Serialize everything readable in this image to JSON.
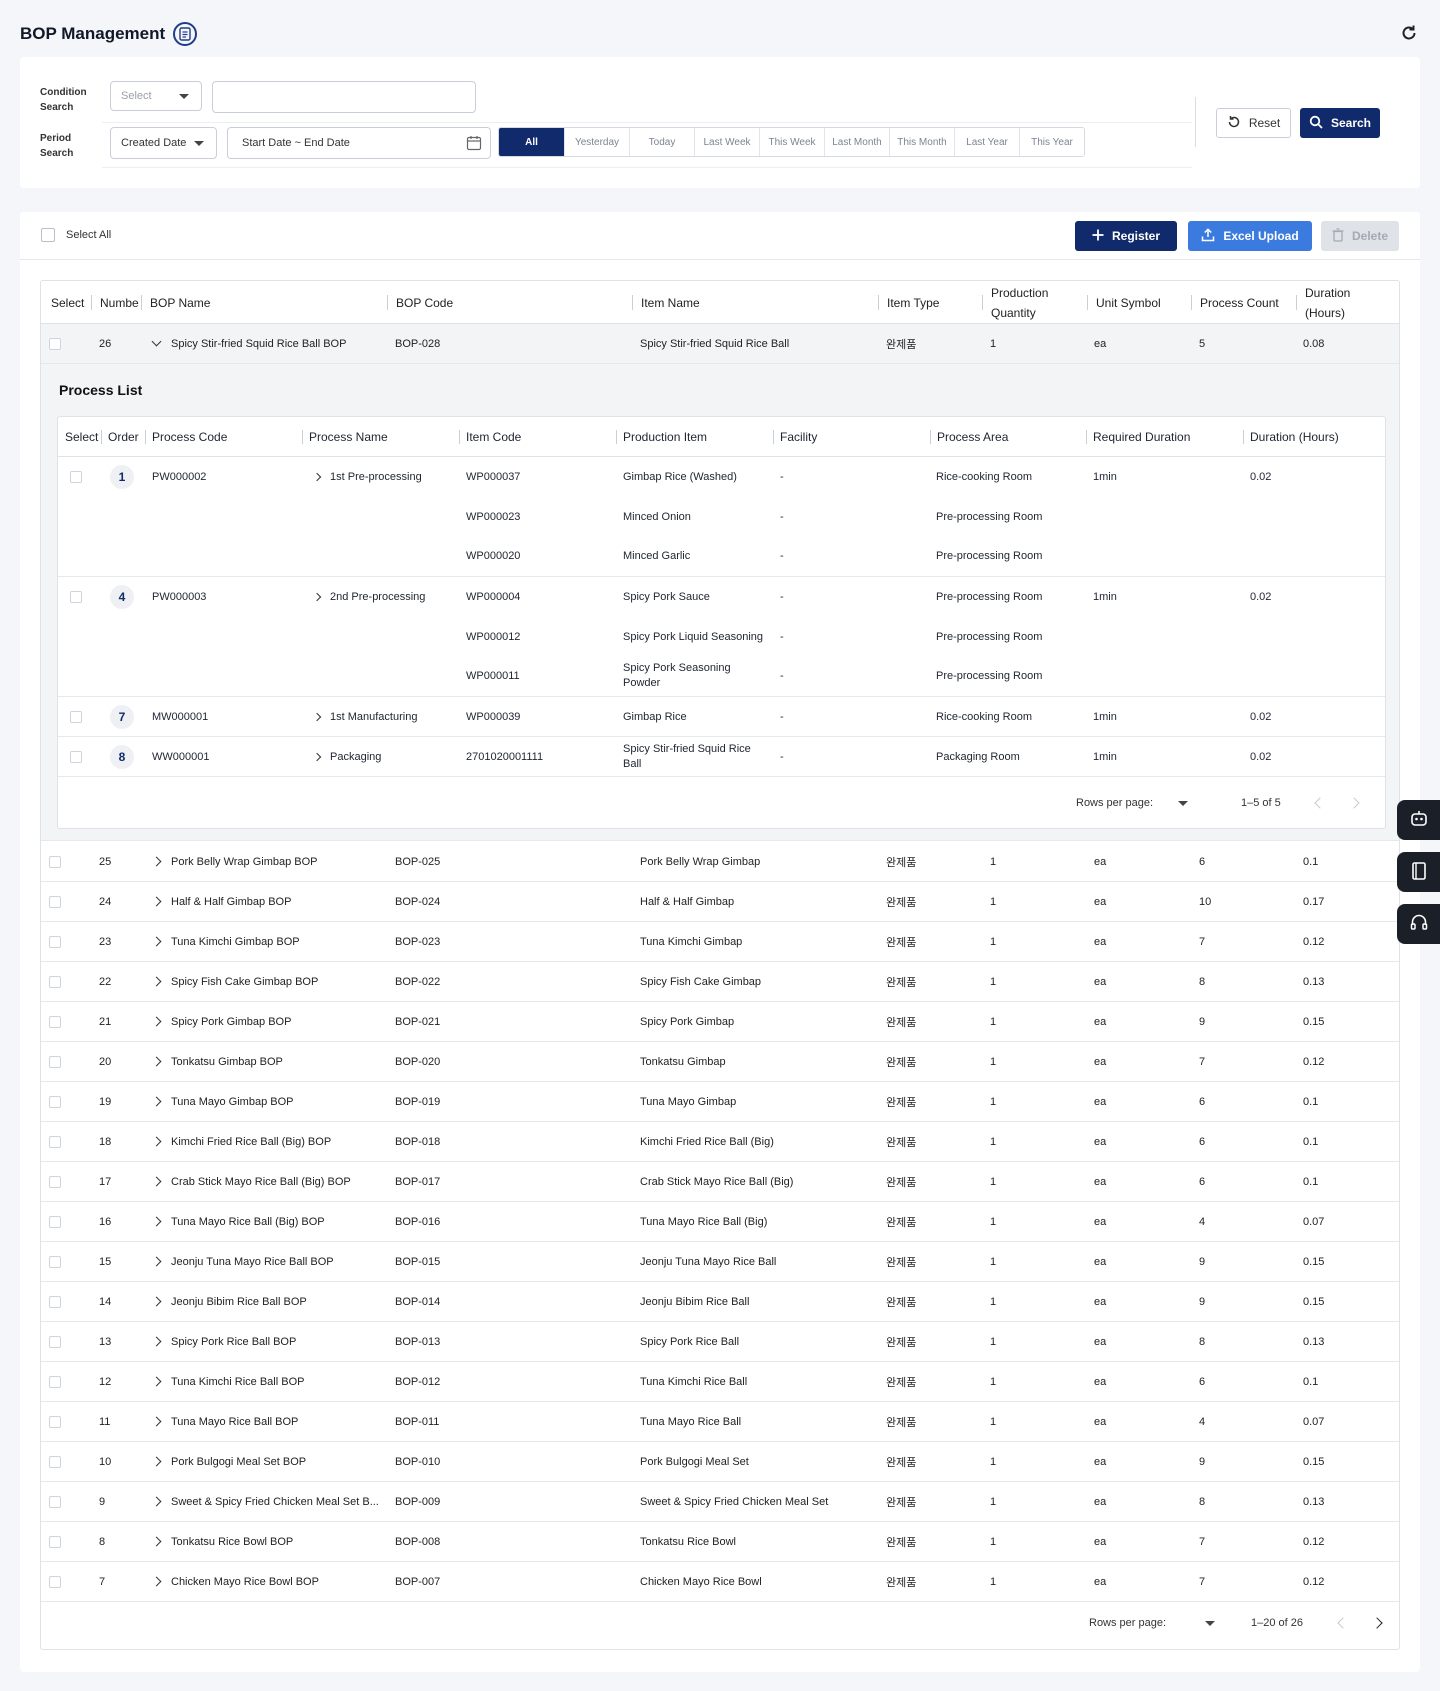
{
  "page": {
    "title": "BOP Management"
  },
  "search": {
    "condition_label": "Condition\nSearch",
    "condition_select": "Select",
    "condition_value": "",
    "period_label": "Period\nSearch",
    "period_select": "Created Date",
    "date_range": "Start Date ~ End Date",
    "periods": [
      "All",
      "Yesterday",
      "Today",
      "Last Week",
      "This Week",
      "Last Month",
      "This Month",
      "Last Year",
      "This Year"
    ],
    "reset_label": "Reset",
    "search_label": "Search"
  },
  "toolbar": {
    "select_all": "Select All",
    "register": "Register",
    "excel_upload": "Excel Upload",
    "delete": "Delete"
  },
  "table": {
    "headers": {
      "select": "Select",
      "number": "Numbe",
      "bop_name": "BOP Name",
      "bop_code": "BOP Code",
      "item_name": "Item Name",
      "item_type": "Item Type",
      "production_quantity": "Production Quantity",
      "unit_symbol": "Unit Symbol",
      "process_count": "Process Count",
      "duration": "Duration (Hours)"
    },
    "expanded_row": {
      "number": "26",
      "bop_name": "Spicy Stir-fried Squid Rice Ball BOP",
      "bop_code": "BOP-028",
      "item_name": "Spicy Stir-fried Squid Rice Ball",
      "item_type": "완제품",
      "qty": "1",
      "unit": "ea",
      "process_count": "5",
      "duration": "0.08"
    },
    "rows": [
      {
        "number": "25",
        "bop_name": "Pork Belly Wrap Gimbap BOP",
        "bop_code": "BOP-025",
        "item_name": "Pork Belly Wrap Gimbap",
        "item_type": "완제품",
        "qty": "1",
        "unit": "ea",
        "process_count": "6",
        "duration": "0.1"
      },
      {
        "number": "24",
        "bop_name": "Half & Half Gimbap BOP",
        "bop_code": "BOP-024",
        "item_name": "Half & Half Gimbap",
        "item_type": "완제품",
        "qty": "1",
        "unit": "ea",
        "process_count": "10",
        "duration": "0.17"
      },
      {
        "number": "23",
        "bop_name": "Tuna Kimchi Gimbap BOP",
        "bop_code": "BOP-023",
        "item_name": "Tuna Kimchi Gimbap",
        "item_type": "완제품",
        "qty": "1",
        "unit": "ea",
        "process_count": "7",
        "duration": "0.12"
      },
      {
        "number": "22",
        "bop_name": "Spicy Fish Cake Gimbap BOP",
        "bop_code": "BOP-022",
        "item_name": "Spicy Fish Cake Gimbap",
        "item_type": "완제품",
        "qty": "1",
        "unit": "ea",
        "process_count": "8",
        "duration": "0.13"
      },
      {
        "number": "21",
        "bop_name": "Spicy Pork Gimbap BOP",
        "bop_code": "BOP-021",
        "item_name": "Spicy Pork Gimbap",
        "item_type": "완제품",
        "qty": "1",
        "unit": "ea",
        "process_count": "9",
        "duration": "0.15"
      },
      {
        "number": "20",
        "bop_name": "Tonkatsu Gimbap BOP",
        "bop_code": "BOP-020",
        "item_name": "Tonkatsu Gimbap",
        "item_type": "완제품",
        "qty": "1",
        "unit": "ea",
        "process_count": "7",
        "duration": "0.12"
      },
      {
        "number": "19",
        "bop_name": "Tuna Mayo Gimbap BOP",
        "bop_code": "BOP-019",
        "item_name": "Tuna Mayo Gimbap",
        "item_type": "완제품",
        "qty": "1",
        "unit": "ea",
        "process_count": "6",
        "duration": "0.1"
      },
      {
        "number": "18",
        "bop_name": "Kimchi Fried Rice Ball (Big) BOP",
        "bop_code": "BOP-018",
        "item_name": "Kimchi Fried Rice Ball (Big)",
        "item_type": "완제품",
        "qty": "1",
        "unit": "ea",
        "process_count": "6",
        "duration": "0.1"
      },
      {
        "number": "17",
        "bop_name": "Crab Stick Mayo Rice Ball (Big) BOP",
        "bop_code": "BOP-017",
        "item_name": "Crab Stick Mayo Rice Ball (Big)",
        "item_type": "완제품",
        "qty": "1",
        "unit": "ea",
        "process_count": "6",
        "duration": "0.1"
      },
      {
        "number": "16",
        "bop_name": "Tuna Mayo Rice Ball (Big) BOP",
        "bop_code": "BOP-016",
        "item_name": "Tuna Mayo Rice Ball (Big)",
        "item_type": "완제품",
        "qty": "1",
        "unit": "ea",
        "process_count": "4",
        "duration": "0.07"
      },
      {
        "number": "15",
        "bop_name": "Jeonju Tuna Mayo Rice Ball BOP",
        "bop_code": "BOP-015",
        "item_name": "Jeonju Tuna Mayo Rice Ball",
        "item_type": "완제품",
        "qty": "1",
        "unit": "ea",
        "process_count": "9",
        "duration": "0.15"
      },
      {
        "number": "14",
        "bop_name": "Jeonju Bibim Rice Ball BOP",
        "bop_code": "BOP-014",
        "item_name": "Jeonju Bibim Rice Ball",
        "item_type": "완제품",
        "qty": "1",
        "unit": "ea",
        "process_count": "9",
        "duration": "0.15"
      },
      {
        "number": "13",
        "bop_name": "Spicy Pork Rice Ball BOP",
        "bop_code": "BOP-013",
        "item_name": "Spicy Pork Rice Ball",
        "item_type": "완제품",
        "qty": "1",
        "unit": "ea",
        "process_count": "8",
        "duration": "0.13"
      },
      {
        "number": "12",
        "bop_name": "Tuna Kimchi Rice Ball BOP",
        "bop_code": "BOP-012",
        "item_name": "Tuna Kimchi Rice Ball",
        "item_type": "완제품",
        "qty": "1",
        "unit": "ea",
        "process_count": "6",
        "duration": "0.1"
      },
      {
        "number": "11",
        "bop_name": "Tuna Mayo Rice Ball BOP",
        "bop_code": "BOP-011",
        "item_name": "Tuna Mayo Rice Ball",
        "item_type": "완제품",
        "qty": "1",
        "unit": "ea",
        "process_count": "4",
        "duration": "0.07"
      },
      {
        "number": "10",
        "bop_name": "Pork Bulgogi Meal Set BOP",
        "bop_code": "BOP-010",
        "item_name": "Pork Bulgogi Meal Set",
        "item_type": "완제품",
        "qty": "1",
        "unit": "ea",
        "process_count": "9",
        "duration": "0.15"
      },
      {
        "number": "9",
        "bop_name": "Sweet & Spicy Fried Chicken Meal Set B...",
        "bop_code": "BOP-009",
        "item_name": "Sweet & Spicy Fried Chicken Meal Set",
        "item_type": "완제품",
        "qty": "1",
        "unit": "ea",
        "process_count": "8",
        "duration": "0.13"
      },
      {
        "number": "8",
        "bop_name": "Tonkatsu Rice Bowl BOP",
        "bop_code": "BOP-008",
        "item_name": "Tonkatsu Rice Bowl",
        "item_type": "완제품",
        "qty": "1",
        "unit": "ea",
        "process_count": "7",
        "duration": "0.12"
      },
      {
        "number": "7",
        "bop_name": "Chicken Mayo Rice Bowl BOP",
        "bop_code": "BOP-007",
        "item_name": "Chicken Mayo Rice Bowl",
        "item_type": "완제품",
        "qty": "1",
        "unit": "ea",
        "process_count": "7",
        "duration": "0.12"
      }
    ],
    "footer": {
      "rows_per_page": "Rows per page:",
      "range": "1–20 of 26"
    }
  },
  "process_list": {
    "title": "Process List",
    "headers": {
      "select": "Select",
      "order": "Order",
      "process_code": "Process Code",
      "process_name": "Process Name",
      "item_code": "Item Code",
      "production_item": "Production Item",
      "facility": "Facility",
      "process_area": "Process Area",
      "required_duration": "Required Duration",
      "duration": "Duration (Hours)"
    },
    "processes": [
      {
        "order": "1",
        "code": "PW000002",
        "name": "1st Pre-processing",
        "required": "1min",
        "duration": "0.02",
        "items": [
          {
            "code": "WP000037",
            "item": "Gimbap Rice (Washed)",
            "facility": "-",
            "area": "Rice-cooking Room"
          },
          {
            "code": "WP000023",
            "item": "Minced Onion",
            "facility": "-",
            "area": "Pre-processing Room"
          },
          {
            "code": "WP000020",
            "item": "Minced Garlic",
            "facility": "-",
            "area": "Pre-processing Room"
          }
        ]
      },
      {
        "order": "4",
        "code": "PW000003",
        "name": "2nd Pre-processing",
        "required": "1min",
        "duration": "0.02",
        "items": [
          {
            "code": "WP000004",
            "item": "Spicy Pork Sauce",
            "facility": "-",
            "area": "Pre-processing Room"
          },
          {
            "code": "WP000012",
            "item": "Spicy Pork Liquid Seasoning",
            "facility": "-",
            "area": "Pre-processing Room"
          },
          {
            "code": "WP000011",
            "item": "Spicy Pork Seasoning Powder",
            "facility": "-",
            "area": "Pre-processing Room"
          }
        ]
      },
      {
        "order": "7",
        "code": "MW000001",
        "name": "1st Manufacturing",
        "required": "1min",
        "duration": "0.02",
        "items": [
          {
            "code": "WP000039",
            "item": "Gimbap Rice",
            "facility": "-",
            "area": "Rice-cooking Room"
          }
        ]
      },
      {
        "order": "8",
        "code": "WW000001",
        "name": "Packaging",
        "required": "1min",
        "duration": "0.02",
        "items": [
          {
            "code": "2701020001111",
            "item": "Spicy Stir-fried Squid Rice Ball",
            "facility": "-",
            "area": "Packaging Room"
          }
        ]
      }
    ],
    "footer": {
      "rows_per_page": "Rows per page:",
      "range": "1–5 of 5"
    }
  },
  "colors": {
    "primary": "#102a6b",
    "accent": "#3b7be0",
    "background": "#f4f6fa"
  },
  "icons": [
    "document-icon",
    "refresh-icon",
    "calendar-icon",
    "reset-icon",
    "search-icon",
    "plus-icon",
    "upload-icon",
    "trash-icon",
    "robot-icon",
    "book-icon",
    "headset-icon"
  ]
}
